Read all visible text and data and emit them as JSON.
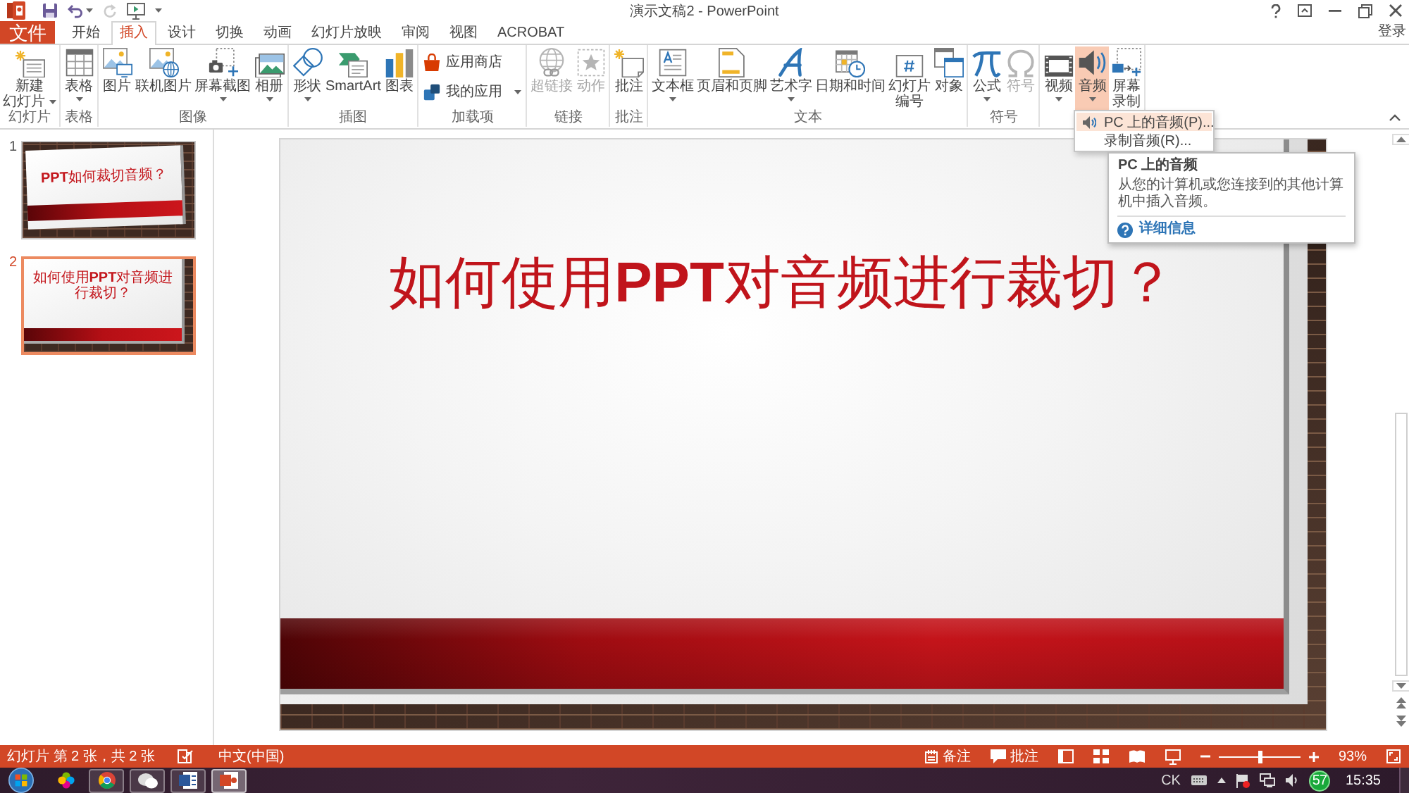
{
  "window": {
    "title": "演示文稿2 - PowerPoint",
    "sign_in": "登录"
  },
  "quick_access": [
    {
      "menu": false,
      "disabled": false
    },
    {
      "menu": true,
      "disabled": false
    },
    {
      "menu": false,
      "disabled": true
    },
    {
      "menu": false,
      "disabled": false
    }
  ],
  "tabs": [
    {
      "label": "文件",
      "kind": "backstage",
      "selected": false
    },
    {
      "label": "开始",
      "kind": "tab",
      "selected": false
    },
    {
      "label": "插入",
      "kind": "tab",
      "selected": true
    },
    {
      "label": "设计",
      "kind": "tab",
      "selected": false
    },
    {
      "label": "切换",
      "kind": "tab",
      "selected": false
    },
    {
      "label": "动画",
      "kind": "tab",
      "selected": false
    },
    {
      "label": "幻灯片放映",
      "kind": "tab",
      "selected": false
    },
    {
      "label": "审阅",
      "kind": "tab",
      "selected": false
    },
    {
      "label": "视图",
      "kind": "tab",
      "selected": false
    },
    {
      "label": "ACROBAT",
      "kind": "tab",
      "selected": false
    }
  ],
  "ribbon": {
    "groups": [
      {
        "buttons": [
          {
            "label": "新建幻灯片",
            "kind": "stacked",
            "menu": true,
            "disabled": false,
            "open": false
          }
        ],
        "label": "幻灯片"
      },
      {
        "buttons": [
          {
            "label": "表格",
            "kind": "large",
            "menu": true,
            "disabled": false,
            "open": false
          }
        ],
        "label": "表格"
      },
      {
        "buttons": [
          {
            "label": "图片",
            "kind": "large",
            "menu": false,
            "disabled": false,
            "open": false
          },
          {
            "label": "联机图片",
            "kind": "large",
            "menu": false,
            "disabled": false,
            "open": false
          },
          {
            "label": "屏幕截图",
            "kind": "large",
            "menu": true,
            "disabled": false,
            "open": false
          },
          {
            "label": "相册",
            "kind": "large",
            "menu": true,
            "disabled": false,
            "open": false
          }
        ],
        "label": "图像"
      },
      {
        "buttons": [
          {
            "label": "形状",
            "kind": "large",
            "menu": true,
            "disabled": false,
            "open": false
          },
          {
            "label": "SmartArt",
            "kind": "large",
            "menu": false,
            "disabled": false,
            "open": false
          },
          {
            "label": "图表",
            "kind": "large",
            "menu": false,
            "disabled": false,
            "open": false
          }
        ],
        "label": "插图"
      },
      {
        "buttons": [
          {
            "label": "应用商店",
            "kind": "small",
            "menu": false,
            "disabled": false,
            "open": false
          },
          {
            "label": "我的应用",
            "kind": "small",
            "menu": true,
            "disabled": false,
            "open": false
          }
        ],
        "label": "加载项"
      },
      {
        "buttons": [
          {
            "label": "超链接",
            "kind": "large",
            "menu": false,
            "disabled": true,
            "open": false
          },
          {
            "label": "动作",
            "kind": "large",
            "menu": false,
            "disabled": true,
            "open": false
          }
        ],
        "label": "链接"
      },
      {
        "buttons": [
          {
            "label": "批注",
            "kind": "large",
            "menu": false,
            "disabled": false,
            "open": false
          }
        ],
        "label": "批注"
      },
      {
        "buttons": [
          {
            "label": "文本框",
            "kind": "large",
            "menu": true,
            "disabled": false,
            "open": false
          },
          {
            "label": "页眉和页脚",
            "kind": "large",
            "menu": false,
            "disabled": false,
            "open": false
          },
          {
            "label": "艺术字",
            "kind": "large",
            "menu": true,
            "disabled": false,
            "open": false
          },
          {
            "label": "日期和时间",
            "kind": "large",
            "menu": false,
            "disabled": false,
            "open": false
          },
          {
            "label": "幻灯片编号",
            "kind": "stacked",
            "menu": false,
            "disabled": false,
            "open": false
          },
          {
            "label": "对象",
            "kind": "large",
            "menu": false,
            "disabled": false,
            "open": false
          }
        ],
        "label": "文本"
      },
      {
        "buttons": [
          {
            "label": "公式",
            "kind": "large",
            "menu": true,
            "disabled": false,
            "open": false
          },
          {
            "label": "符号",
            "kind": "large",
            "menu": false,
            "disabled": true,
            "open": false
          }
        ],
        "label": "符号"
      },
      {
        "buttons": [
          {
            "label": "视频",
            "kind": "large",
            "menu": true,
            "disabled": false,
            "open": false
          },
          {
            "label": "音频",
            "kind": "large",
            "menu": true,
            "disabled": false,
            "open": true
          },
          {
            "label": "屏幕录制",
            "kind": "stacked",
            "menu": false,
            "disabled": false,
            "open": false
          }
        ]
      }
    ]
  },
  "audio_menu": {
    "items": [
      {
        "label": "PC 上的音频(P)...",
        "selected": true
      },
      {
        "label": "录制音频(R)...",
        "selected": false
      }
    ],
    "tooltip": {
      "title": "PC 上的音频",
      "body": "从您的计算机或您连接到的其他计算机中插入音频。",
      "link": "详细信息"
    }
  },
  "slides": [
    {
      "number": "1",
      "kind": "title",
      "title": "**PPT**如何裁切音频？",
      "selected": false
    },
    {
      "number": "2",
      "kind": "content",
      "title": "如何使用**PPT**对音频进行裁切？",
      "selected": true
    }
  ],
  "slide": {
    "title": "如何使用**PPT**对音频进行裁切？"
  },
  "status_bar": {
    "slide_info": "幻灯片 第 2 张，共 2 张",
    "language": "中文(中国)",
    "notes": "备注",
    "comments": "批注",
    "zoom": {
      "level": 0.5,
      "reading": "93%"
    }
  },
  "taskbar": {
    "apps": [
      {
        "running": false,
        "active": false
      },
      {
        "running": true,
        "active": false
      },
      {
        "running": true,
        "active": false
      },
      {
        "running": true,
        "active": false
      },
      {
        "running": true,
        "active": true
      }
    ],
    "input_method": "CK",
    "badge": "57",
    "clock": "15:35"
  }
}
